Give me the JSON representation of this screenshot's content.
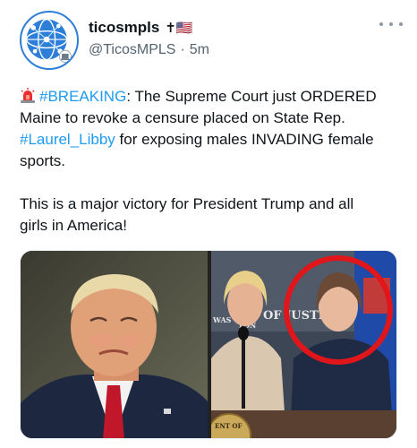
{
  "tweet": {
    "author": {
      "display_name": "ticosmpls",
      "name_emoji": "✝🇺🇸",
      "handle": "@TicosMPLS",
      "separator": "·",
      "time": "5m",
      "avatar_icon": "globe-network-logo-icon"
    },
    "more_icon": "more-horizontal-icon",
    "text": {
      "siren_icon": "police-siren-emoji-icon",
      "hashtag_breaking": "#BREAKING",
      "line1_after_hashtag": ": The Supreme Court just ORDERED",
      "line2": "Maine to revoke a censure placed on State Rep.",
      "hashtag_libby": "#Laurel_Libby",
      "line3_after_hashtag": " for exposing males INVADING female",
      "line4": "sports.",
      "paragraph2_line1": "This is a major victory for President Trump and all",
      "paragraph2_line2": "girls in America!"
    },
    "media": {
      "left_image": "smiling-man-in-suit-photo",
      "right_image": "press-conference-photo",
      "overlay_text_1": "OF JUSTICE",
      "overlay_text_2": "WAS",
      "overlay_text_3": "TON",
      "seal_text": "ENT OF",
      "highlight_color": "#e0161b"
    },
    "colors": {
      "link": "#1d9bf0",
      "text": "#0f1419",
      "secondary": "#536471"
    }
  }
}
